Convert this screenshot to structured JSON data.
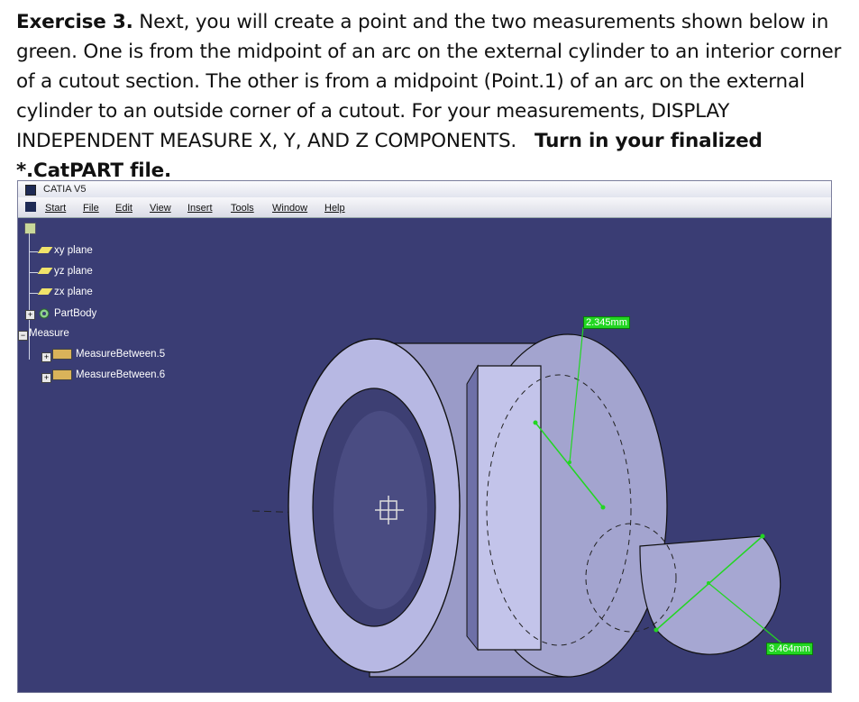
{
  "exercise": {
    "lead": "Exercise 3.",
    "body": " Next, you will create a point and the two measurements shown below in green. One is from the midpoint of an arc on the external cylinder to an interior corner of a cutout section. The other is from a midpoint (Point.1) of an arc on the external cylinder to an outside corner of a cutout. For your measurements, DISPLAY INDEPENDENT MEASURE X, Y, AND Z COMPONENTS.",
    "turnin": "Turn in your finalized *.CatPART file."
  },
  "window": {
    "title": "CATIA V5",
    "menu": [
      "Start",
      "File",
      "Edit",
      "View",
      "Insert",
      "Tools",
      "Window",
      "Help"
    ]
  },
  "tree": {
    "planes": [
      "xy plane",
      "yz plane",
      "zx plane"
    ],
    "partbody": "PartBody",
    "measure": "Measure",
    "measurements": [
      "MeasureBetween.5",
      "MeasureBetween.6"
    ]
  },
  "measurement_labels": {
    "first": "2.345mm",
    "second": "3.464mm"
  },
  "colors": {
    "viewport": "#3a3d74",
    "part_fill": "#b7b8e3",
    "part_shadow": "#9596c6",
    "measure_green": "#22d622"
  },
  "icons": [
    "catia-app-icon",
    "start-icon",
    "plane-icon",
    "partbody-gear-icon",
    "measure-icon",
    "axis-compass-icon"
  ]
}
